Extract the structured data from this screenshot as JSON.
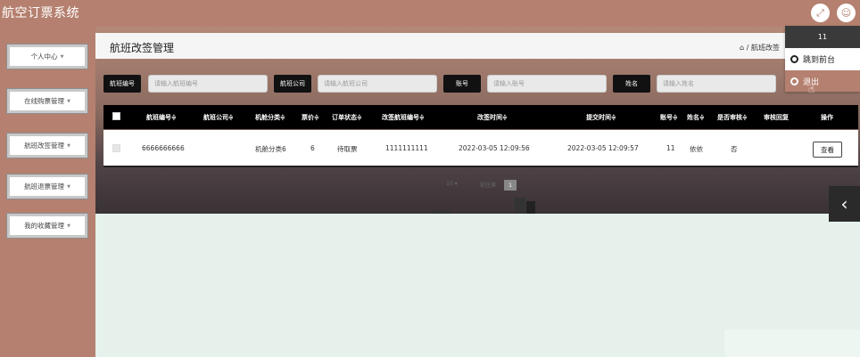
{
  "app_title": "航空订票系统",
  "icons": {
    "expand": "expand-icon",
    "user": "user-icon"
  },
  "sidebar": {
    "items": [
      {
        "label": "个人中心"
      },
      {
        "label": "在线购票管理"
      },
      {
        "label": "航班改签管理"
      },
      {
        "label": "航班退票管理"
      },
      {
        "label": "我的收藏管理"
      }
    ]
  },
  "header": {
    "title": "航班改签管理",
    "breadcrumb": "/ 航班改签"
  },
  "search": {
    "fields": [
      {
        "label": "航班编号",
        "placeholder": "请输入航班编号"
      },
      {
        "label": "航班公司",
        "placeholder": "请输入航班公司"
      },
      {
        "label": "账号",
        "placeholder": "请输入账号"
      },
      {
        "label": "姓名",
        "placeholder": "请输入姓名"
      }
    ]
  },
  "table": {
    "columns": [
      "航班编号≑",
      "航班公司≑",
      "机舱分类≑",
      "票价≑",
      "订单状态≑",
      "改签航班编号≑",
      "改签时间≑",
      "提交时间≑",
      "账号≑",
      "姓名≑",
      "是否审核≑",
      "审核回复",
      "操作"
    ],
    "rows": [
      {
        "flight_no": "6666666666",
        "company": "",
        "cabin": "机舱分类6",
        "price": "6",
        "status": "待取票",
        "new_flight_no": "1111111111",
        "change_time": "2022-03-05 12:09:56",
        "submit_time": "2022-03-05 12:09:57",
        "account": "11",
        "name": "依依",
        "reviewed": "否",
        "reply": "",
        "action": "查看"
      }
    ]
  },
  "pagination": {
    "page_size": "10",
    "current_page": "1",
    "goto_label": "前往第"
  },
  "user_menu": {
    "username": "11",
    "items": [
      {
        "label": "跳到前台"
      },
      {
        "label": "退出"
      }
    ]
  },
  "colors": {
    "sidebar": "#b5806f",
    "header_black": "#000000",
    "background": "#e6f1ec"
  }
}
